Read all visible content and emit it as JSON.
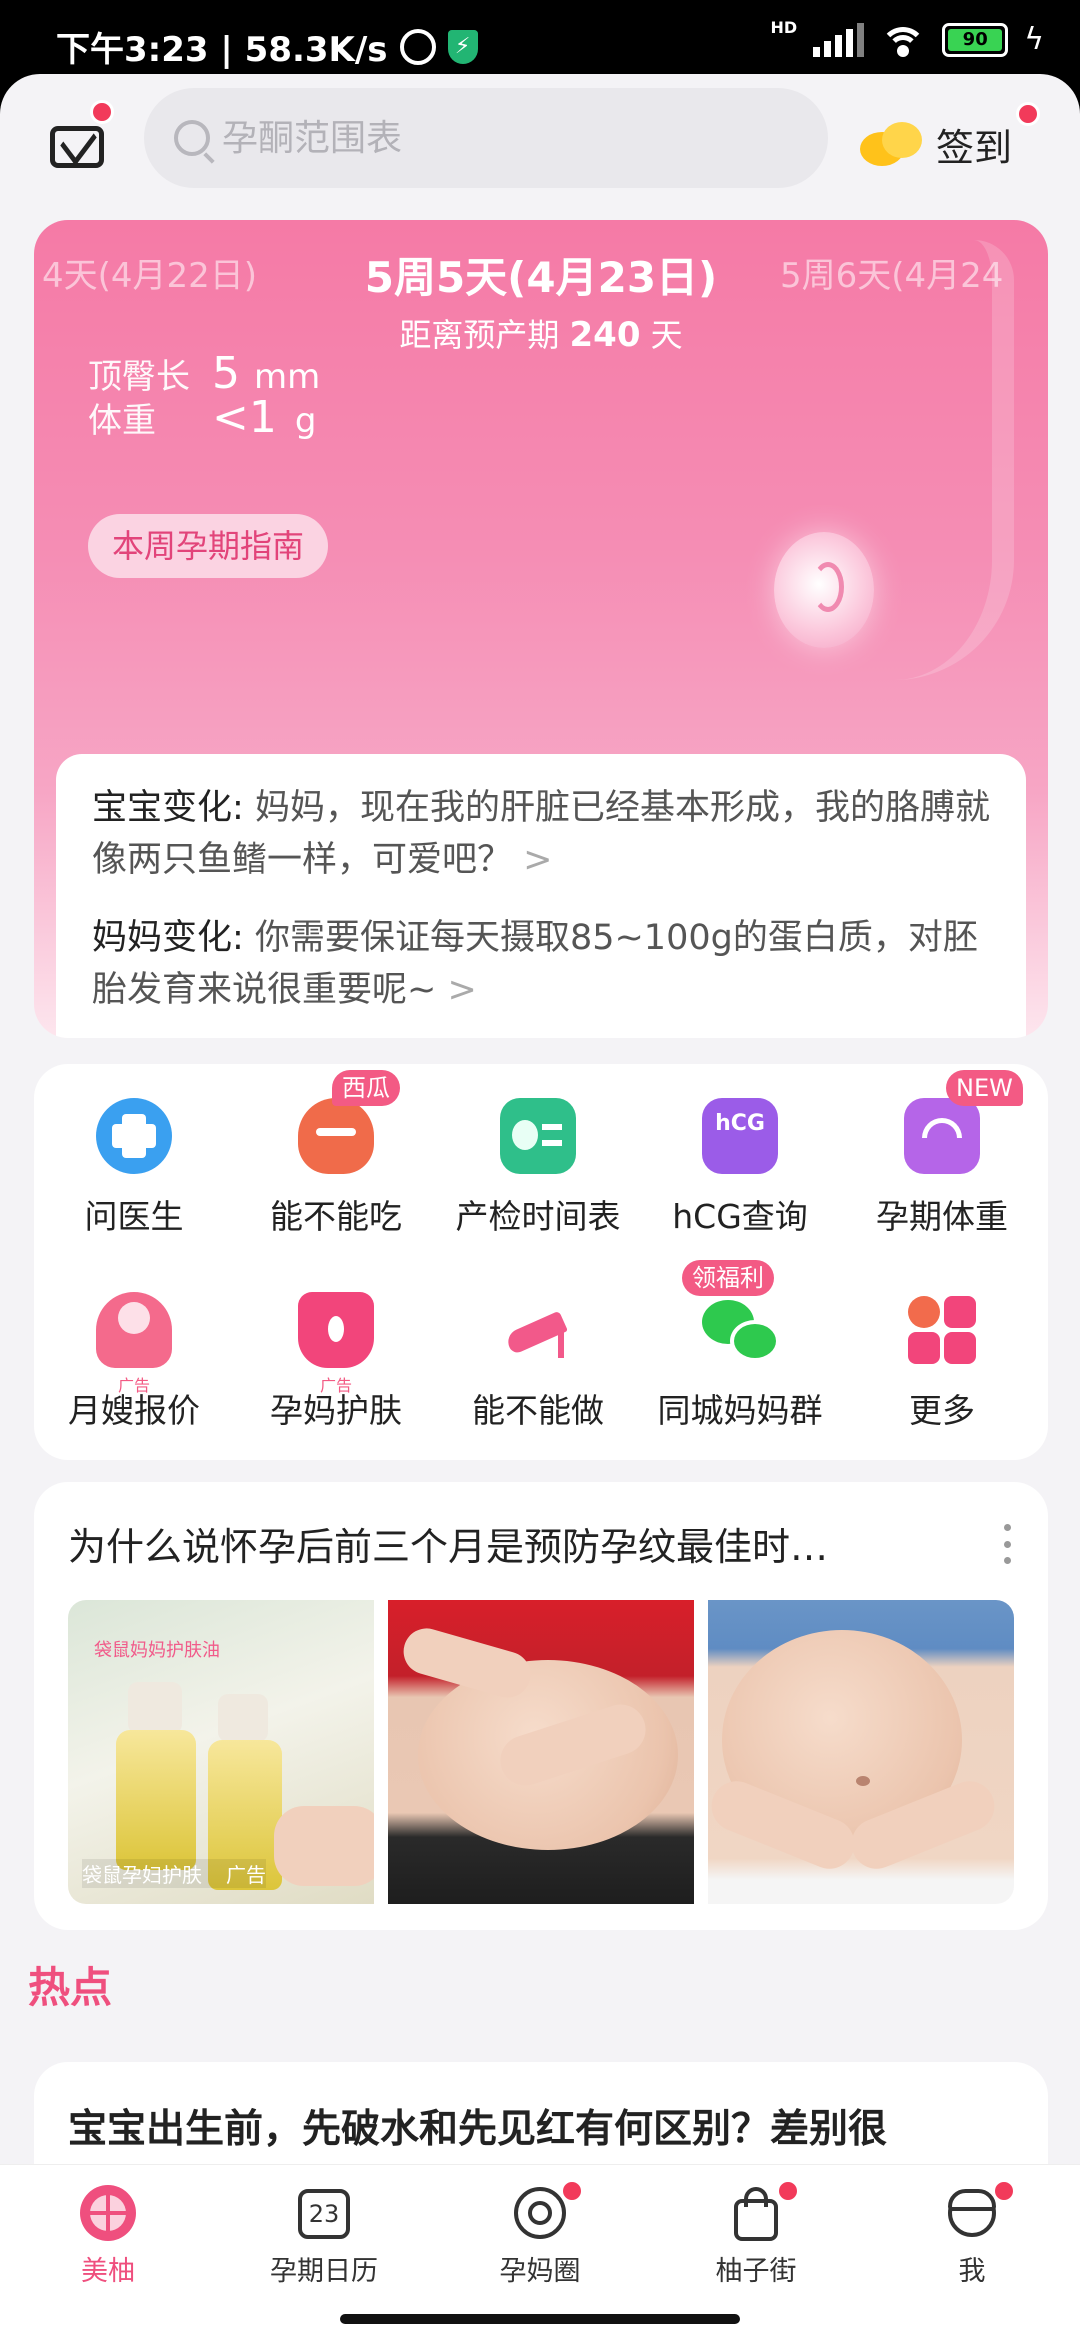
{
  "status_bar": {
    "time_speed": "下午3:23 | 58.3K/s",
    "network": "HD",
    "battery": "90"
  },
  "top_bar": {
    "search_placeholder": "孕酮范围表",
    "checkin_label": "签到"
  },
  "hero": {
    "prev_week": "4天(4月22日)",
    "current_week": "5周5天(4月23日)",
    "next_week": "5周6天(4月24",
    "due_prefix": "距离预产期",
    "due_days": "240",
    "due_suffix": "天",
    "crl_label": "顶臀长",
    "crl_value": "5",
    "crl_unit": "mm",
    "weight_label": "体重",
    "weight_value": "<1",
    "weight_unit": "g",
    "guide_button": "本周孕期指南",
    "baby_change_key": "宝宝变化:",
    "baby_change_text": "妈妈，现在我的肝脏已经基本形成，我的胳膊就像两只鱼鳍一样，可爱吧？",
    "mom_change_key": "妈妈变化:",
    "mom_change_text": "你需要保证每天摄取85~100g的蛋白质，对胚胎发育来说很重要呢~",
    "chevron": ">"
  },
  "tools": [
    {
      "label": "问医生",
      "icon": "doctor-chat-icon",
      "tag": ""
    },
    {
      "label": "能不能吃",
      "icon": "crab-icon",
      "tag": "西瓜"
    },
    {
      "label": "产检时间表",
      "icon": "checkup-schedule-icon",
      "tag": ""
    },
    {
      "label": "hCG查询",
      "icon": "hcg-chart-icon",
      "tag": ""
    },
    {
      "label": "孕期体重",
      "icon": "scale-icon",
      "tag": "NEW"
    },
    {
      "label": "月嫂报价",
      "icon": "nanny-icon",
      "tag": "",
      "ad": "广告"
    },
    {
      "label": "孕妈护肤",
      "icon": "skincare-icon",
      "tag": "",
      "ad": "广告"
    },
    {
      "label": "能不能做",
      "icon": "high-heel-icon",
      "tag": ""
    },
    {
      "label": "同城妈妈群",
      "icon": "wechat-group-icon",
      "tag": "领福利"
    },
    {
      "label": "更多",
      "icon": "grid-more-icon",
      "tag": ""
    }
  ],
  "article": {
    "title": "为什么说怀孕后前三个月是预防孕纹最佳时…",
    "thumb_overlay": "袋鼠妈妈护肤油",
    "thumb_brand": "袋鼠孕妇护肤",
    "thumb_ad": "广告"
  },
  "hot": {
    "heading": "热点",
    "title": "宝宝出生前，先破水和先见红有何区别？差别很"
  },
  "tabbar": [
    {
      "label": "美柚",
      "icon": "meiyou-home-icon",
      "active": true,
      "badge": false
    },
    {
      "label": "孕期日历",
      "icon": "calendar-icon",
      "active": false,
      "badge": false,
      "day": "23"
    },
    {
      "label": "孕妈圈",
      "icon": "community-icon",
      "active": false,
      "badge": true
    },
    {
      "label": "柚子街",
      "icon": "shopping-bag-icon",
      "active": false,
      "badge": true
    },
    {
      "label": "我",
      "icon": "profile-icon",
      "active": false,
      "badge": true
    }
  ],
  "colors": {
    "accent": "#ef4f7e",
    "badge": "#f23a5a",
    "hero_pink": "#f57aa6"
  }
}
